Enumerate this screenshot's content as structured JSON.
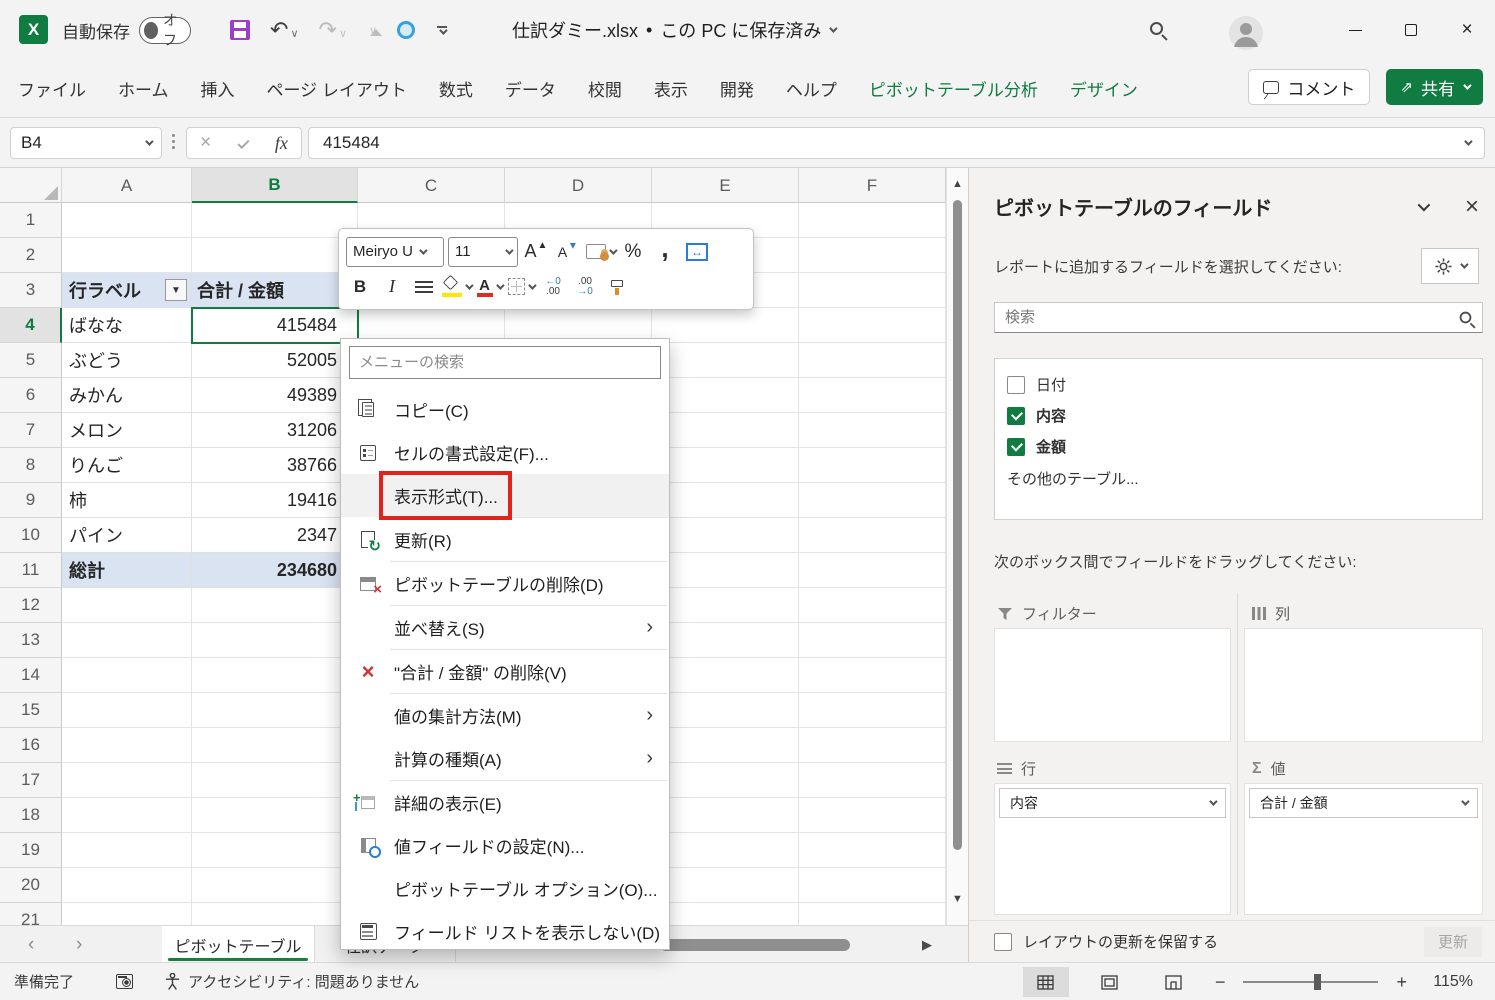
{
  "titlebar": {
    "autosave_label": "自動保存",
    "autosave_state": "オフ",
    "filename": "仕訳ダミー.xlsx",
    "separator": "•",
    "save_status": "この PC に保存済み"
  },
  "ribbon": {
    "tabs": [
      "ファイル",
      "ホーム",
      "挿入",
      "ページ レイアウト",
      "数式",
      "データ",
      "校閲",
      "表示",
      "開発",
      "ヘルプ"
    ],
    "context_tabs": [
      "ピボットテーブル分析",
      "デザイン"
    ],
    "comment_label": "コメント",
    "share_label": "共有"
  },
  "formula_bar": {
    "name_box": "B4",
    "fx_label": "fx",
    "value": "415484"
  },
  "grid": {
    "columns": [
      "A",
      "B",
      "C",
      "D",
      "E",
      "F"
    ],
    "selected_column": "B",
    "row_numbers": [
      1,
      2,
      3,
      4,
      5,
      6,
      7,
      8,
      9,
      10,
      11,
      12,
      13,
      14,
      15,
      16,
      17,
      18,
      19,
      20,
      21
    ],
    "selected_row": 4,
    "pivot": {
      "header": {
        "row_label": "行ラベル",
        "value_label": "合計 / 金額"
      },
      "rows": [
        {
          "label": "ばなな",
          "value": "415484"
        },
        {
          "label": "ぶどう",
          "value": "52005"
        },
        {
          "label": "みかん",
          "value": "49389"
        },
        {
          "label": "メロン",
          "value": "31206"
        },
        {
          "label": "りんご",
          "value": "38766"
        },
        {
          "label": "柿",
          "value": "19416"
        },
        {
          "label": "パイン",
          "value": "2347"
        }
      ],
      "total": {
        "label": "総計",
        "value": "234680"
      }
    }
  },
  "mini_toolbar": {
    "font_name": "Meiryo U",
    "font_size": "11",
    "grow_font_label": "A",
    "shrink_font_label": "A",
    "percent_label": "%",
    "bold_label": "B",
    "italic_label": "I",
    "font_color_letter": "A",
    "autofit_glyph": "↔",
    "increase_decimal_glyph": "←0\n.00",
    "decrease_decimal_glyph": ".00\n→0"
  },
  "context_menu": {
    "search_placeholder": "メニューの検索",
    "items": [
      {
        "label": "コピー(C)"
      },
      {
        "label": "セルの書式設定(F)..."
      },
      {
        "label": "表示形式(T)..."
      },
      {
        "label": "更新(R)"
      },
      {
        "label": "ピボットテーブルの削除(D)"
      },
      {
        "label": "並べ替え(S)"
      },
      {
        "label": "\"合計 / 金額\" の削除(V)"
      },
      {
        "label": "値の集計方法(M)"
      },
      {
        "label": "計算の種類(A)"
      },
      {
        "label": "詳細の表示(E)"
      },
      {
        "label": "値フィールドの設定(N)..."
      },
      {
        "label": "ピボットテーブル オプション(O)..."
      },
      {
        "label": "フィールド リストを表示しない(D)"
      }
    ]
  },
  "field_pane": {
    "title": "ピボットテーブルのフィールド",
    "choose_fields_label": "レポートに追加するフィールドを選択してください:",
    "search_placeholder": "検索",
    "fields": [
      {
        "name": "日付",
        "checked": false
      },
      {
        "name": "内容",
        "checked": true
      },
      {
        "name": "金額",
        "checked": true
      }
    ],
    "more_tables_label": "その他のテーブル...",
    "drag_hint": "次のボックス間でフィールドをドラッグしてください:",
    "areas": {
      "filters_label": "フィルター",
      "columns_label": "列",
      "rows_label": "行",
      "values_label": "値",
      "rows_item": "内容",
      "values_item": "合計 / 金額"
    },
    "defer_layout_label": "レイアウトの更新を保留する",
    "update_button_label": "更新"
  },
  "sheet_tabs": {
    "active_tab": "ピボットテーブル",
    "inactive_tab": "仕訳データ"
  },
  "status_bar": {
    "ready_label": "準備完了",
    "accessibility_label": "アクセシビリティ: 問題ありません",
    "zoom_level": "115%"
  },
  "colors": {
    "excel_green": "#107c41",
    "context_tab_green": "#0f7b40",
    "annotation_red": "#e0241c",
    "pivot_header_blue": "#dae3f2"
  }
}
